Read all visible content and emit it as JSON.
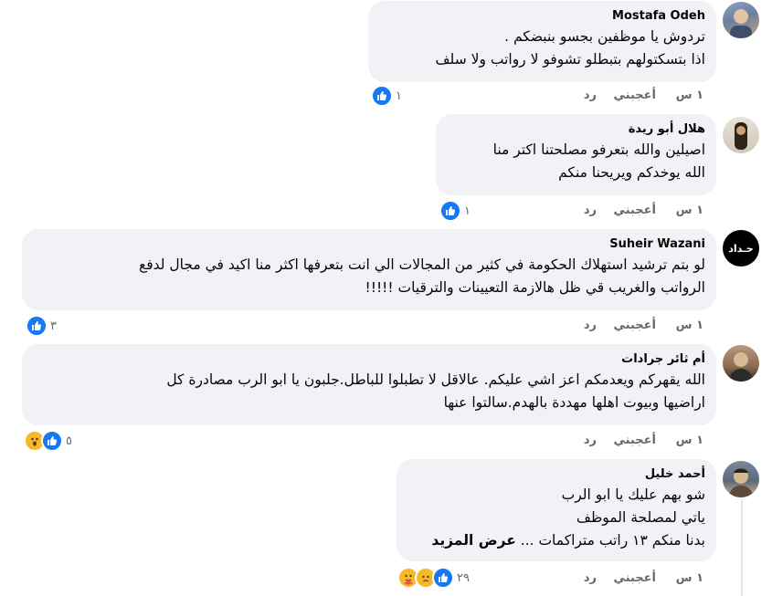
{
  "comments": [
    {
      "author": "Mostafa Odeh",
      "text": "تردوش يا موظفين بجسو بنبضكم .\nاذا بتسكتولهم بتبطلو تشوفو لا رواتب ولا سلف",
      "time": "١ س",
      "like_label": "أعجبني",
      "reply_label": "رد",
      "reaction_count": "١",
      "reactions": [
        "like-icon"
      ],
      "avatar_colors": [
        "#6b7fa0",
        "#c9a27a"
      ]
    },
    {
      "author": "هلال أبو ريدة",
      "text": "اصيلين والله بتعرفو مصلحتنا اكتر منا\nالله يوخدكم ويريحنا منكم",
      "time": "١ س",
      "like_label": "أعجبني",
      "reply_label": "رد",
      "reaction_count": "١",
      "reactions": [
        "like-icon"
      ],
      "avatar_colors": [
        "#d9d4c8",
        "#3a2a20"
      ]
    },
    {
      "author": "Suheir Wazani",
      "text": "لو بتم ترشيد استهلاك الحكومة في كثير من المجالات الي انت بتعرفها اكثر منا اكيد في مجال لدفع\nالرواتب والغريب قي ظل هالازمة التعيينات والترقيات !!!!!",
      "time": "١ س",
      "like_label": "أعجبني",
      "reply_label": "رد",
      "reaction_count": "٣",
      "reactions": [
        "like-icon"
      ],
      "avatar_text": "حـداد",
      "avatar_colors": [
        "#000000",
        "#ffffff"
      ]
    },
    {
      "author": "أم ثائر جرادات",
      "text": "الله يقهركم ويعدمكم اعز اشي عليكم. عالاقل لا تطبلوا للباطل.جلبون يا ابو الرب مصادرة كل\nاراضيها وبيوت اهلها مهددة بالهدم.سالتوا عنها",
      "time": "١ س",
      "like_label": "أعجبني",
      "reply_label": "رد",
      "reaction_count": "٥",
      "reactions": [
        "like-icon",
        "wow-icon"
      ],
      "avatar_colors": [
        "#8a6a50",
        "#2b2b2b"
      ]
    },
    {
      "author": "أحمد خليل",
      "text": "شو بهم عليك يا ابو الرب\nياتي لمصلحة الموظف\nبدنا منكم ١٣ راتب متراكمات ...",
      "see_more": "عرض المزيد",
      "time": "١ س",
      "like_label": "أعجبني",
      "reply_label": "رد",
      "reaction_count": "٢٩",
      "reactions": [
        "like-icon",
        "sad-icon",
        "care-icon"
      ],
      "avatar_colors": [
        "#5a6a7a",
        "#d8b890"
      ]
    }
  ]
}
